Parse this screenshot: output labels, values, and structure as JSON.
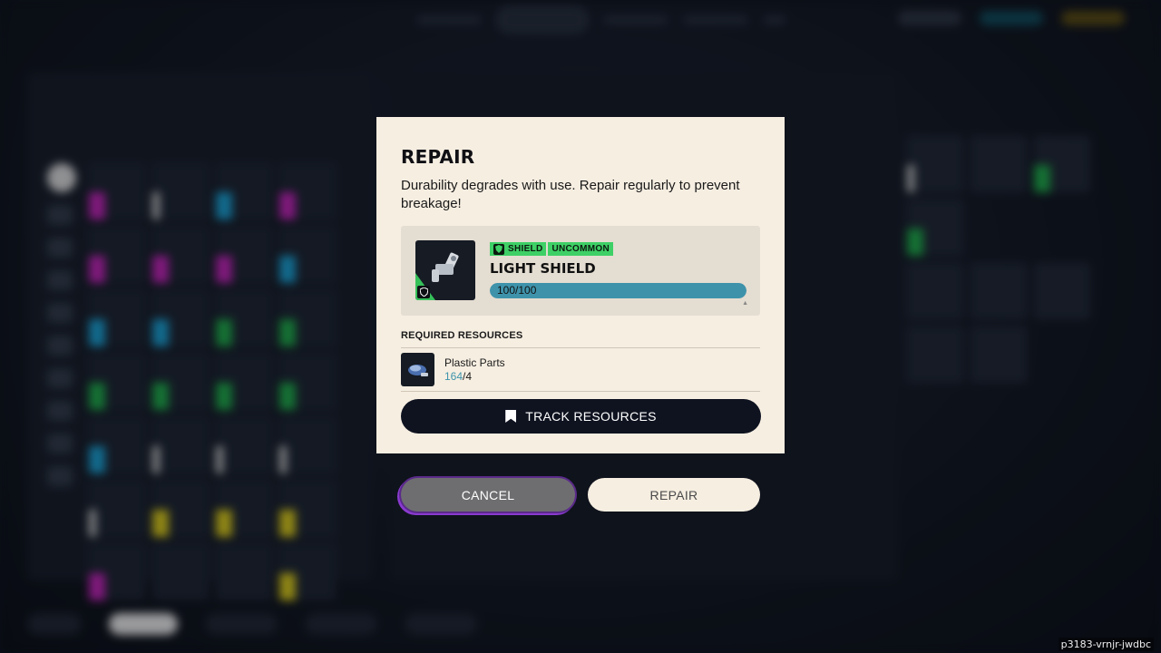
{
  "modal": {
    "title": "REPAIR",
    "description": "Durability degrades with use. Repair regularly to prevent breakage!",
    "item": {
      "type_tag": "SHIELD",
      "rarity_tag": "UNCOMMON",
      "name": "LIGHT SHIELD",
      "durability_text": "100/100",
      "durability_fraction": 1.0,
      "rarity_color": "#3ed066",
      "icon": "light-shield-icon"
    },
    "required_resources_label": "REQUIRED RESOURCES",
    "resources": [
      {
        "name": "Plastic Parts",
        "have": "164",
        "separator": "/",
        "need": "4",
        "icon": "plastic-parts-icon"
      }
    ],
    "track_button_label": "TRACK RESOURCES"
  },
  "actions": {
    "cancel_label": "CANCEL",
    "repair_label": "REPAIR"
  },
  "watermark": "p3183-vrnjr-jwdbc",
  "colors": {
    "modal_bg": "#f6eee1",
    "accent_blue": "#3e93ab",
    "dark_button": "#0f1320",
    "uncommon_green": "#3ed066"
  }
}
